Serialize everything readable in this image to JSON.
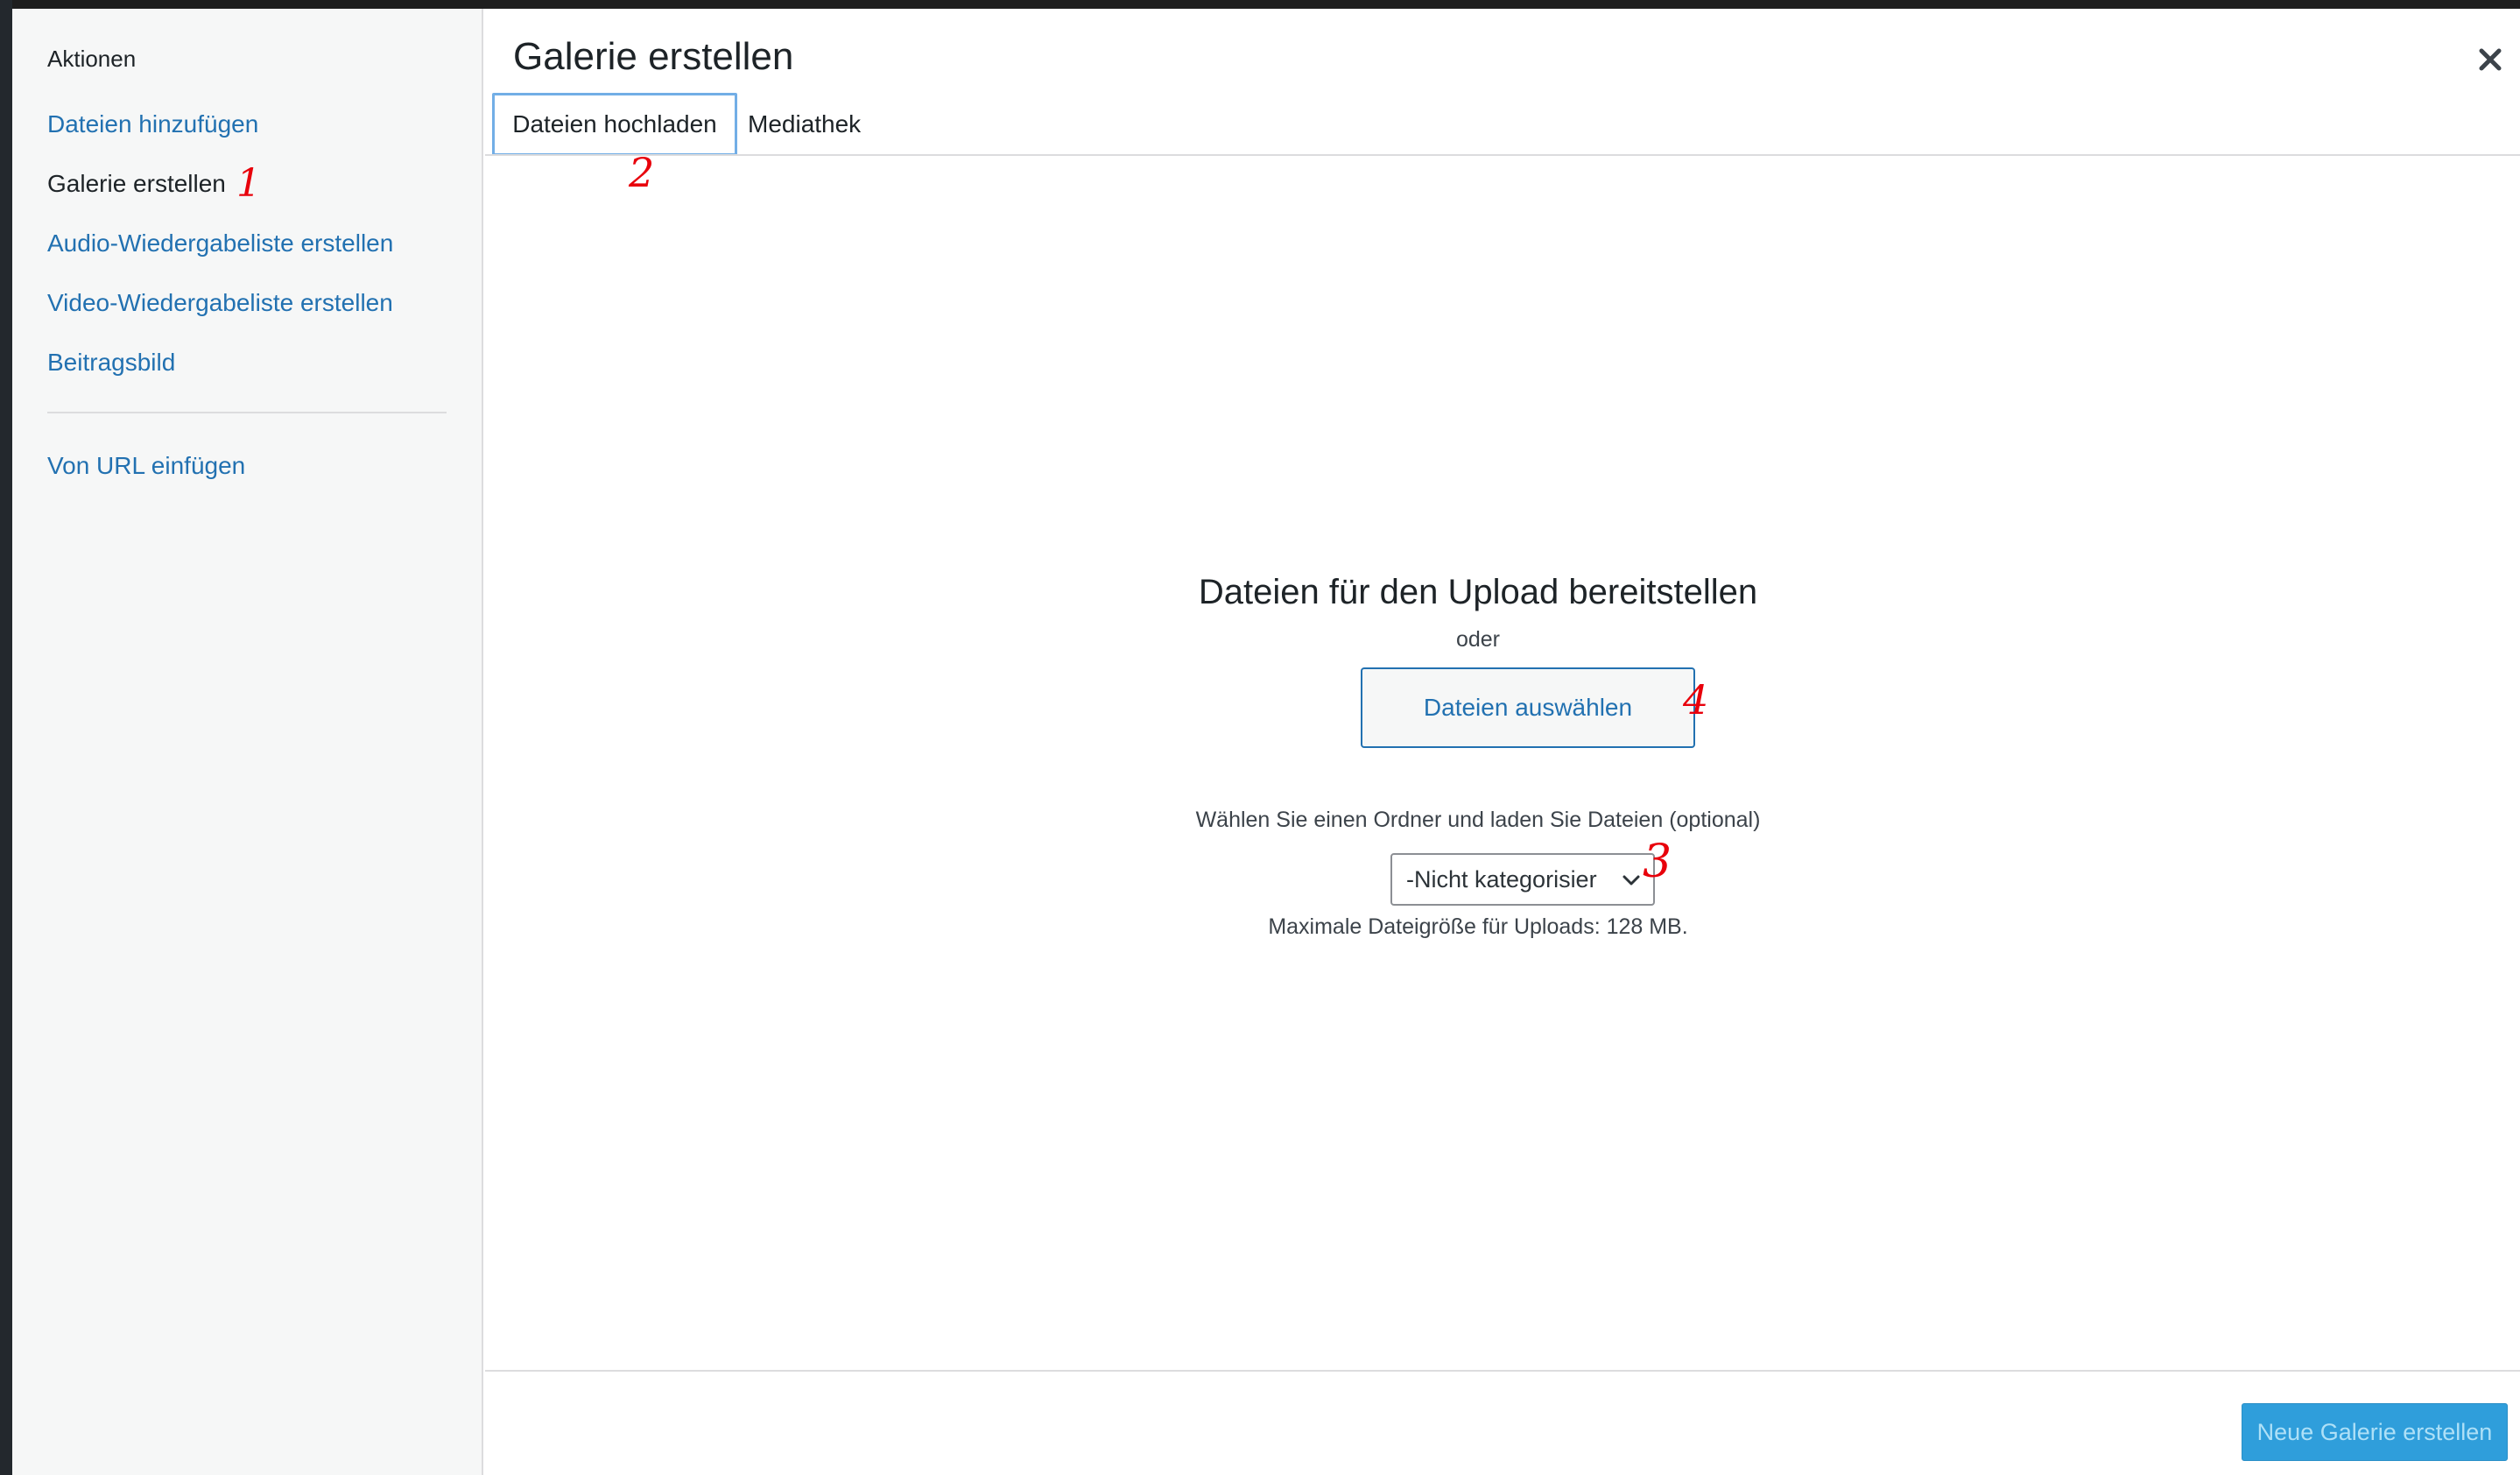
{
  "colors": {
    "accent": "#2271b1",
    "annotation": "#e8000b",
    "primary_button_bg": "#2f9edb",
    "sidebar_bg": "#f6f7f7"
  },
  "sidebar": {
    "heading": "Aktionen",
    "items": [
      {
        "label": "Dateien hinzufügen",
        "active": false
      },
      {
        "label": "Galerie erstellen",
        "active": true
      },
      {
        "label": "Audio-Wiedergabeliste erstellen",
        "active": false
      },
      {
        "label": "Video-Wiedergabeliste erstellen",
        "active": false
      },
      {
        "label": "Beitragsbild",
        "active": false
      }
    ],
    "extra_item": "Von URL einfügen"
  },
  "header": {
    "title": "Galerie erstellen",
    "close_icon": "close-icon"
  },
  "tabs": [
    {
      "label": "Dateien hochladen",
      "active": true
    },
    {
      "label": "Mediathek",
      "active": false
    }
  ],
  "uploader": {
    "drop_title": "Dateien für den Upload bereitstellen",
    "or_text": "oder",
    "select_button": "Dateien auswählen",
    "folder_hint": "Wählen Sie einen Ordner und laden Sie Dateien (optional)",
    "folder_select_value": "-Nicht kategorisier",
    "max_size": "Maximale Dateigröße für Uploads: 128 MB."
  },
  "toolbar": {
    "primary_button": "Neue Galerie erstellen"
  },
  "annotations": [
    "1",
    "2",
    "3",
    "4"
  ]
}
